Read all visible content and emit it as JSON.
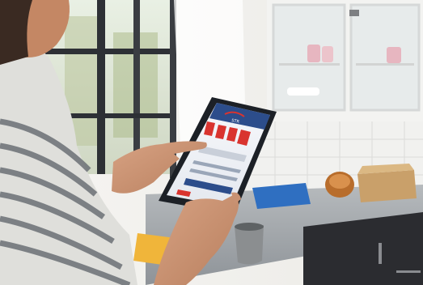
{
  "scene": {
    "tablet_logo_text": "STR",
    "palette": {
      "wall": "#f4f2ee",
      "window_light": "#eef3ea",
      "counter": "#9aa0a5",
      "cabinet_dark": "#2b2c30",
      "tablet_body": "#1c2026",
      "screen_header": "#2c4d8b",
      "screen_banner": "#d9342f",
      "folder_blue": "#2f6fc1",
      "package_yellow": "#f0b53a"
    }
  }
}
